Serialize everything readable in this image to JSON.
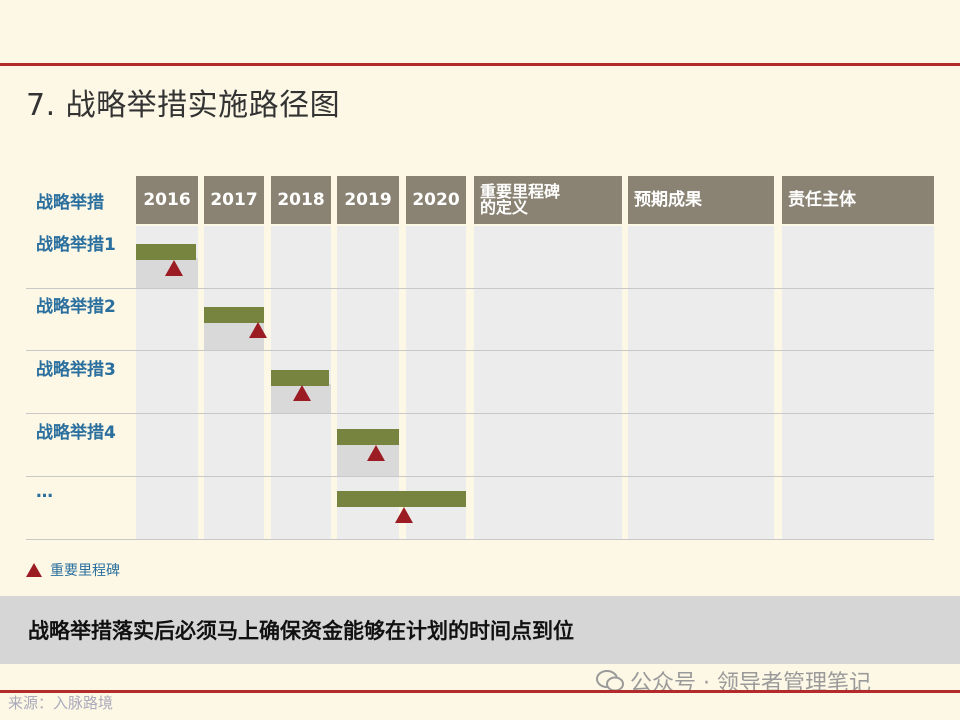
{
  "title": "7. 战略举措实施路径图",
  "header": {
    "first": "战略举措",
    "years": [
      "2016",
      "2017",
      "2018",
      "2019",
      "2020"
    ],
    "milestone_def": "重要里程碑\n的定义",
    "milestone_def_line1": "重要里程碑",
    "milestone_def_line2": "的定义",
    "expected": "预期成果",
    "owner": "责任主体"
  },
  "rows": [
    {
      "label": "战略举措1"
    },
    {
      "label": "战略举措2"
    },
    {
      "label": "战略举措3"
    },
    {
      "label": "战略举措4"
    },
    {
      "label": "…"
    }
  ],
  "legend": {
    "label": "重要里程碑"
  },
  "banner": {
    "text": "战略举措落实后必须马上确保资金能够在计划的时间点到位"
  },
  "watermark": {
    "text": "公众号 · 领导者管理笔记"
  },
  "source_footer": {
    "text": "来源：入脉路境"
  },
  "colors": {
    "accent_red": "#b32b2b",
    "bar_green": "#77843f",
    "header_gray": "#8a8373",
    "label_blue": "#2a6f9e",
    "milestone_red": "#9c1c24"
  }
}
